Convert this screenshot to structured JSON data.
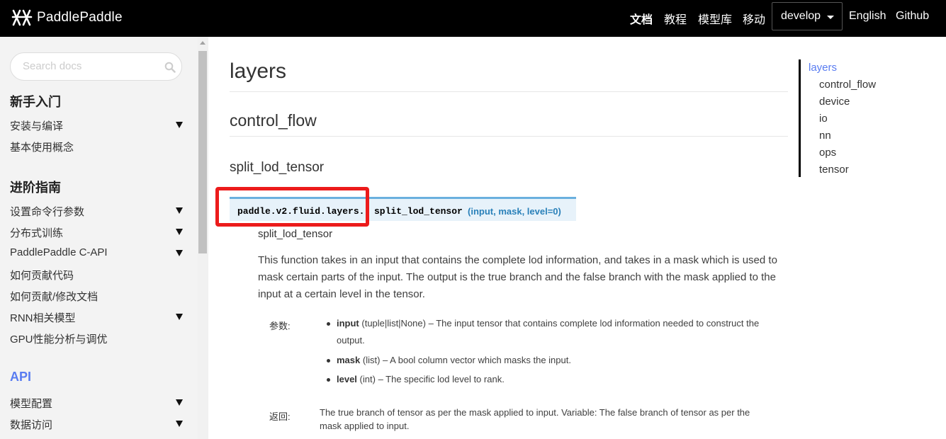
{
  "navbar": {
    "logo_text": "PaddlePaddle",
    "links": [
      "文档",
      "教程",
      "模型库",
      "移动"
    ],
    "version": "develop",
    "english": "English",
    "github": "Github"
  },
  "sidebar": {
    "search_placeholder": "Search docs",
    "sections": [
      {
        "title": "新手入门",
        "items": [
          {
            "label": "安装与编译",
            "expandable": true
          },
          {
            "label": "基本使用概念",
            "expandable": false
          }
        ]
      },
      {
        "title": "进阶指南",
        "items": [
          {
            "label": "设置命令行参数",
            "expandable": true
          },
          {
            "label": "分布式训练",
            "expandable": true
          },
          {
            "label": "PaddlePaddle C-API",
            "expandable": true
          },
          {
            "label": "如何贡献代码",
            "expandable": false
          },
          {
            "label": "如何贡献/修改文档",
            "expandable": false
          },
          {
            "label": "RNN相关模型",
            "expandable": true
          },
          {
            "label": "GPU性能分析与调优",
            "expandable": false
          }
        ]
      },
      {
        "title": "API",
        "items": [
          {
            "label": "模型配置",
            "expandable": true
          },
          {
            "label": "数据访问",
            "expandable": true
          }
        ]
      }
    ]
  },
  "main": {
    "h1": "layers",
    "h2": "control_flow",
    "h3": "split_lod_tensor",
    "signature": {
      "module": "paddle.v2.fluid.layers.",
      "name": "split_lod_tensor",
      "params": "(input, mask, level=0)"
    },
    "desc_title": "split_lod_tensor",
    "description": "This function takes in an input that contains the complete lod information, and takes in a mask which is used to mask certain parts of the input. The output is the true branch and the false branch with the mask applied to the input at a certain level in the tensor.",
    "params_label": "参数:",
    "params": [
      {
        "name": "input",
        "type": "(tuple|list|None)",
        "desc": "– The input tensor that contains complete lod information needed to construct the output."
      },
      {
        "name": "mask",
        "type": "(list)",
        "desc": "– A bool column vector which masks the input."
      },
      {
        "name": "level",
        "type": "(int)",
        "desc": "– The specific lod level to rank."
      }
    ],
    "returns_label": "返回:",
    "returns": "The true branch of tensor as per the mask applied to input. Variable: The false branch of tensor as per the mask applied to input."
  },
  "toc": {
    "head": "layers",
    "items": [
      "control_flow",
      "device",
      "io",
      "nn",
      "ops",
      "tensor"
    ]
  },
  "colors": {
    "accent": "#597cf1",
    "highlight": "#ec1b1b",
    "signature_bg": "#e7f2fa",
    "param_color": "#2980b9"
  }
}
